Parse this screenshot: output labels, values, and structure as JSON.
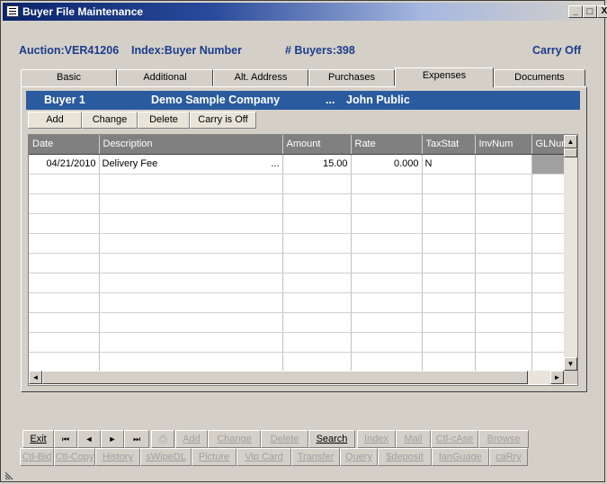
{
  "window": {
    "title": "Buyer File Maintenance",
    "controls": {
      "minimize": "_",
      "maximize": "□",
      "close": "X"
    }
  },
  "info": {
    "auction": "Auction:VER41206",
    "index": "Index:Buyer Number",
    "buyers": "# Buyers:398",
    "carry": "Carry Off"
  },
  "tabs": [
    {
      "label": "Basic"
    },
    {
      "label": "Additional"
    },
    {
      "label": "Alt. Address"
    },
    {
      "label": "Purchases"
    },
    {
      "label": "Expenses"
    },
    {
      "label": "Documents"
    }
  ],
  "active_tab": "Expenses",
  "buyer": {
    "number": "Buyer 1",
    "company": "Demo Sample Company",
    "ellipsis": "...",
    "name": "John Public"
  },
  "actions": {
    "add": "Add",
    "change": "Change",
    "delete": "Delete",
    "carry": "Carry is Off"
  },
  "grid": {
    "columns": [
      "Date",
      "Description",
      "Amount",
      "Rate",
      "TaxStat",
      "InvNum",
      "GLNum"
    ],
    "rows": [
      {
        "date": "04/21/2010",
        "description": "Delivery Fee",
        "more": "...",
        "amount": "15.00",
        "rate": "0.000",
        "taxstat": "N",
        "invnum": "",
        "glnum": ""
      }
    ]
  },
  "scroll_icons": {
    "up": "▲",
    "down": "▼",
    "left": "◄",
    "right": "►"
  },
  "bottom_row1": {
    "exit": "Exit",
    "first": "⏮",
    "prev": "◄",
    "next": "►",
    "last": "⏭",
    "print": "⎙",
    "add": "Add",
    "change": "Change",
    "delete": "Delete",
    "search": "Search",
    "index": "Index",
    "mail": "Mail",
    "ctlcase": "Ctl-cAse",
    "browse": "Browse"
  },
  "bottom_row2": {
    "ctlbid": "Ctl-Bid",
    "ctlcopy": "Ctl-Copy",
    "history": "History",
    "swipedl": "sWipeDL",
    "picture": "Picture",
    "vipcard": "Vip Card",
    "transfer": "Transfer",
    "query": "Query",
    "deposit": "$deposit",
    "language": "lanGuage",
    "carry": "caRry"
  },
  "colors": {
    "accent": "#2a5b9f",
    "info_text": "#1c3c8c",
    "title_bar": "#0a246a"
  }
}
